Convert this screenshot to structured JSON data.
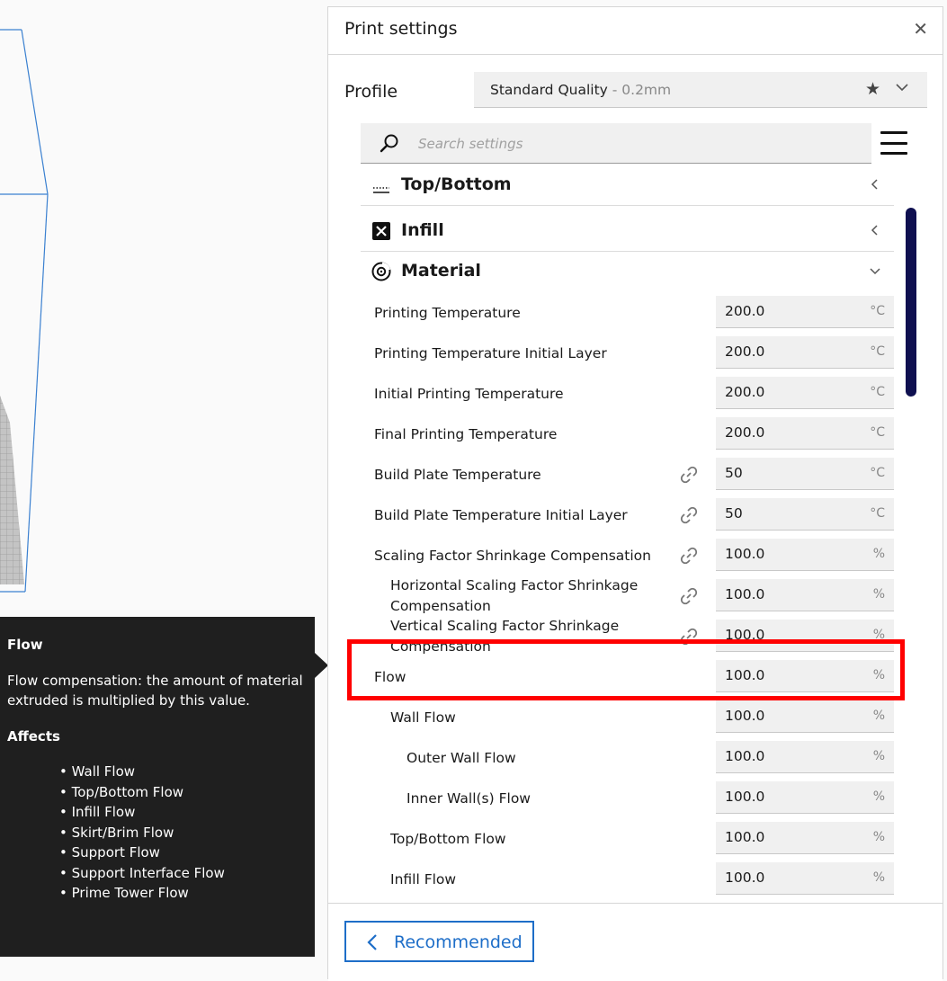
{
  "panel": {
    "title": "Print settings",
    "close_glyph": "✕"
  },
  "profile": {
    "label": "Profile",
    "name": "Standard Quality",
    "layer": " - 0.2mm",
    "star_glyph": "★"
  },
  "search": {
    "placeholder": "Search settings"
  },
  "categories": {
    "top_bottom": {
      "label": "Top/Bottom",
      "icon": "top-bottom-icon",
      "expanded": false
    },
    "infill": {
      "label": "Infill",
      "icon": "infill-icon",
      "expanded": false
    },
    "material": {
      "label": "Material",
      "icon": "material-icon",
      "expanded": true
    }
  },
  "settings": [
    {
      "label": "Printing Temperature",
      "value": "200.0",
      "unit": "°C",
      "linked": false
    },
    {
      "label": "Printing Temperature Initial Layer",
      "value": "200.0",
      "unit": "°C",
      "linked": false
    },
    {
      "label": "Initial Printing Temperature",
      "value": "200.0",
      "unit": "°C",
      "linked": false
    },
    {
      "label": "Final Printing Temperature",
      "value": "200.0",
      "unit": "°C",
      "linked": false
    },
    {
      "label": "Build Plate Temperature",
      "value": "50",
      "unit": "°C",
      "linked": true
    },
    {
      "label": "Build Plate Temperature Initial Layer",
      "value": "50",
      "unit": "°C",
      "linked": true
    },
    {
      "label": "Scaling Factor Shrinkage Compensation",
      "value": "100.0",
      "unit": "%",
      "linked": true
    },
    {
      "label": "Horizontal Scaling Factor Shrinkage Compensation",
      "value": "100.0",
      "unit": "%",
      "linked": true
    },
    {
      "label": "Vertical Scaling Factor Shrinkage Compensation",
      "value": "100.0",
      "unit": "%",
      "linked": true
    },
    {
      "label": "Flow",
      "value": "100.0",
      "unit": "%",
      "linked": false
    },
    {
      "label": "Wall Flow",
      "value": "100.0",
      "unit": "%",
      "linked": false
    },
    {
      "label": "Outer Wall Flow",
      "value": "100.0",
      "unit": "%",
      "linked": false
    },
    {
      "label": "Inner Wall(s) Flow",
      "value": "100.0",
      "unit": "%",
      "linked": false
    },
    {
      "label": "Top/Bottom Flow",
      "value": "100.0",
      "unit": "%",
      "linked": false
    },
    {
      "label": "Infill Flow",
      "value": "100.0",
      "unit": "%",
      "linked": false
    }
  ],
  "tooltip": {
    "title": "Flow",
    "description": "Flow compensation: the amount of material extruded is multiplied by this value.",
    "affects_heading": "Affects",
    "affects": [
      "Wall Flow",
      "Top/Bottom Flow",
      "Infill Flow",
      "Skirt/Brim Flow",
      "Support Flow",
      "Support Interface Flow",
      "Prime Tower Flow"
    ]
  },
  "footer": {
    "recommended_label": "Recommended"
  },
  "colors": {
    "accent": "#1e6ec8",
    "scrollbar": "#0f1050",
    "highlight": "#ff0000",
    "tooltip_bg": "#1f1f1f",
    "wireframe": "#3a80d0"
  }
}
